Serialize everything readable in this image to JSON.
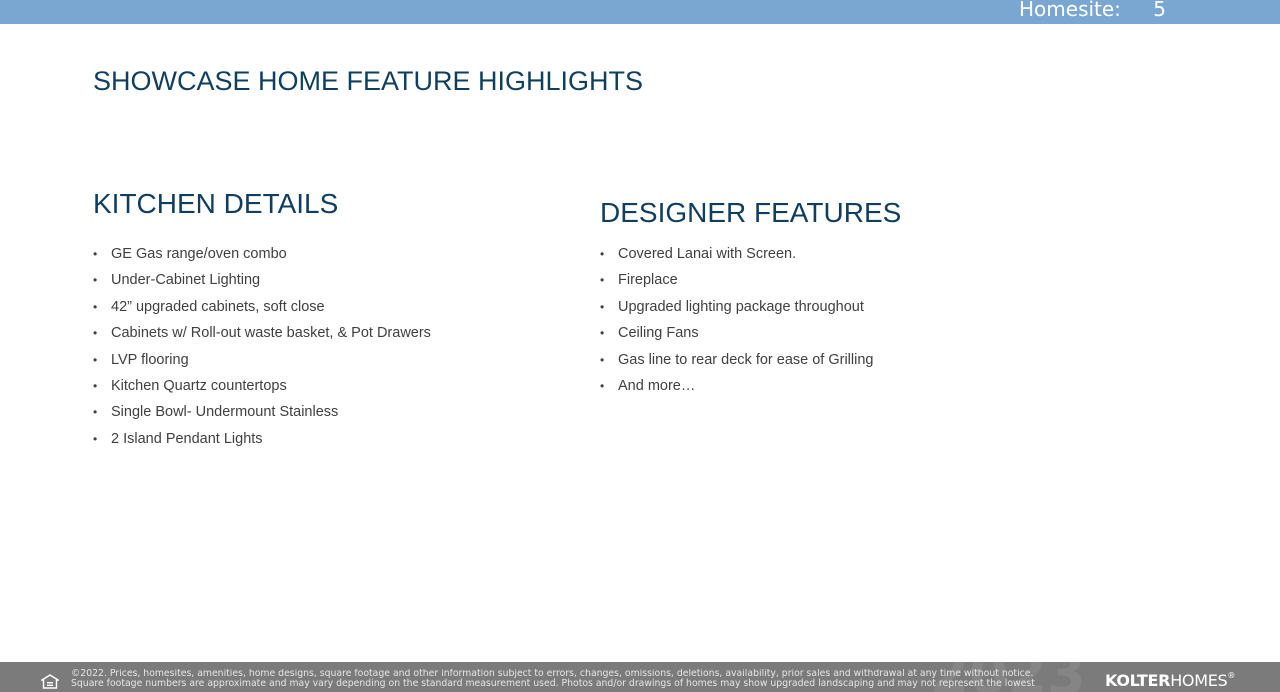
{
  "header": {
    "homesite_label": "Homesite:",
    "homesite_value": "5",
    "bar_color": "#7aa7d2"
  },
  "page_title": "SHOWCASE HOME FEATURE HIGHLIGHTS",
  "kitchen": {
    "title": "KITCHEN DETAILS",
    "items": [
      "GE Gas range/oven combo",
      "Under-Cabinet Lighting",
      "42” upgraded cabinets, soft close",
      "Cabinets w/ Roll-out waste basket, & Pot Drawers",
      "LVP flooring",
      "Kitchen Quartz countertops",
      "Single Bowl- Undermount Stainless",
      "2 Island Pendant Lights"
    ]
  },
  "designer": {
    "title": "DESIGNER FEATURES",
    "items": [
      "Covered Lanai with Screen.",
      "Fireplace",
      "Upgraded lighting package throughout",
      "Ceiling Fans",
      "Gas line to rear deck for ease of Grilling",
      "And more…"
    ]
  },
  "footer": {
    "disclaimer_line1": "©2022. Prices, homesites, amenities, home designs, square footage and other information subject to errors, changes, omissions, deletions, availability, prior sales and withdrawal at any time without notice.",
    "disclaimer_line2": "Square footage numbers are approximate and may vary depending on the standard measurement used. Photos and/or drawings of homes may show upgraded landscaping and may not represent the lowest",
    "watermark": "2023",
    "brand_bold": "KOLTER",
    "brand_regular": "HOMES",
    "brand_mark": "®",
    "icon": "equal-housing-opportunity-icon",
    "background_color": "#7b7b7b"
  }
}
